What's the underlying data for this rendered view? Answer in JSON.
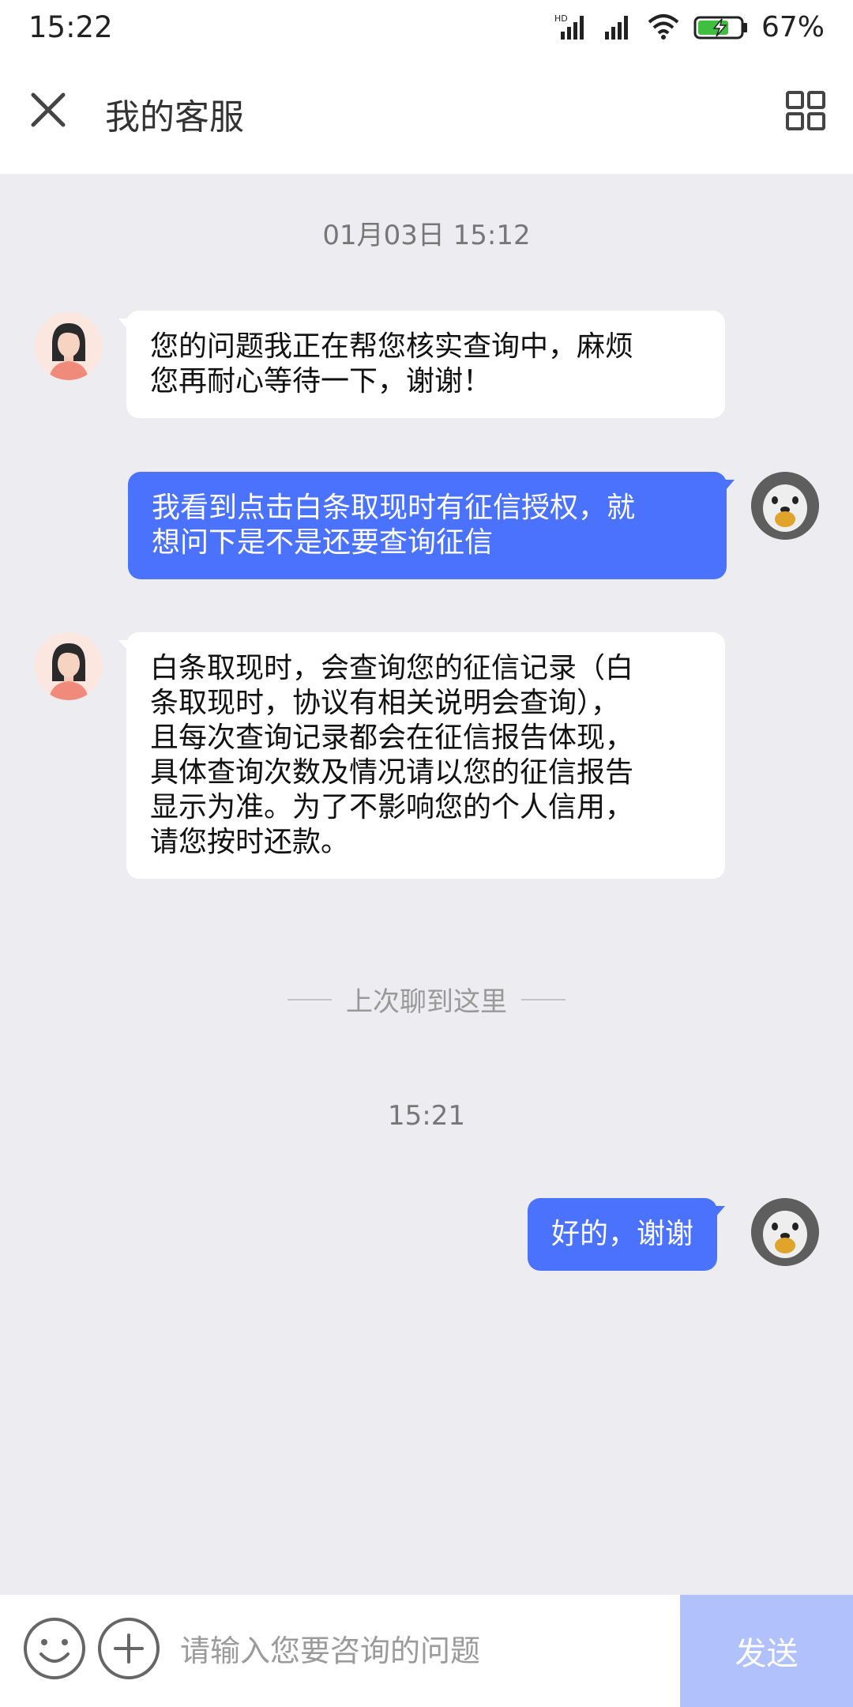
{
  "status_bar": {
    "time": "15:22",
    "battery": "67%",
    "network_badge": "HD",
    "icons": [
      "signal-hd-icon",
      "signal-icon",
      "wifi-icon",
      "battery-charging-icon"
    ]
  },
  "header": {
    "title": "我的客服",
    "close_icon": "close-icon",
    "menu_icon": "grid-icon"
  },
  "messages": [
    {
      "type": "timestamp",
      "text": "01月03日 15:12"
    },
    {
      "type": "agent",
      "text": "您的问题我正在帮您核实查询中，麻烦\n您再耐心等待一下，谢谢！"
    },
    {
      "type": "user",
      "text": "我看到点击白条取现时有征信授权，就\n想问下是不是还要查询征信"
    },
    {
      "type": "agent",
      "text": "白条取现时，会查询您的征信记录（白\n条取现时，协议有相关说明会查询），\n且每次查询记录都会在征信报告体现，\n具体查询次数及情况请以您的征信报告\n显示为准。为了不影响您的个人信用，\n请您按时还款。"
    },
    {
      "type": "divider",
      "text": "上次聊到这里"
    },
    {
      "type": "timestamp",
      "text": "15:21"
    },
    {
      "type": "user",
      "text": "好的，谢谢"
    }
  ],
  "input_bar": {
    "placeholder": "请输入您要咨询的问题",
    "send_label": "发送",
    "emoji_icon": "emoji-icon",
    "plus_icon": "plus-icon"
  },
  "colors": {
    "accent": "#4b72fd",
    "send_disabled": "#b0c1fb",
    "background": "#ededf1"
  }
}
